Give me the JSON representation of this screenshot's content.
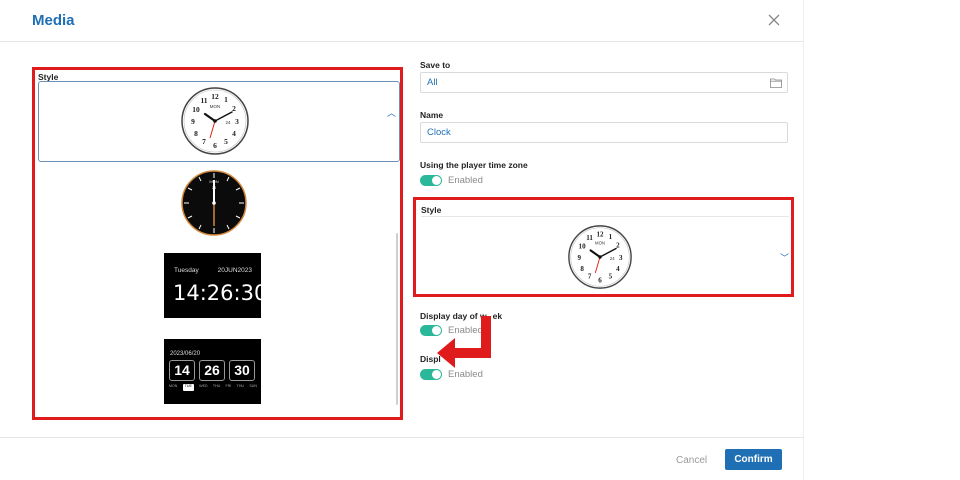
{
  "dialog": {
    "title": "Media",
    "close_icon": "close-icon"
  },
  "left_panel": {
    "style_label": "Style",
    "options": [
      {
        "kind": "analog-white",
        "day": "MON",
        "date": "24",
        "numbers": [
          "12",
          "1",
          "2",
          "3",
          "4",
          "5",
          "6",
          "7",
          "8",
          "9",
          "10",
          "11"
        ]
      },
      {
        "kind": "analog-black",
        "top_text": "MON",
        "date": "24"
      },
      {
        "kind": "digital",
        "weekday": "Tuesday",
        "date": "20JUN2023",
        "time": "14:26:30"
      },
      {
        "kind": "flip",
        "date": "2023/06/20",
        "hours": "14",
        "minutes": "26",
        "seconds": "30",
        "weekdays": [
          "MON",
          "TUE",
          "WED",
          "THU",
          "FRI",
          "THU",
          "SUN"
        ],
        "active_day": "TUE"
      }
    ]
  },
  "form": {
    "save_to": {
      "label": "Save to",
      "value": "All",
      "icon": "folder-icon"
    },
    "name": {
      "label": "Name",
      "value": "Clock"
    },
    "player_time_zone": {
      "label": "Using the player time zone",
      "state": "Enabled"
    },
    "style": {
      "label": "Style",
      "icon": "chevron-down-icon"
    },
    "display_day_of_week": {
      "label": "Display day of week",
      "visible_label": "Display day of w",
      "visible_label_tail": "ek",
      "state": "Enabled"
    },
    "display_other": {
      "label_visible": "Displ",
      "state": "Enabled"
    }
  },
  "footer": {
    "cancel": "Cancel",
    "confirm": "Confirm"
  },
  "colors": {
    "accent": "#1f6fb5",
    "toggle_on": "#2bb89a",
    "highlight": "#e01b1b"
  }
}
